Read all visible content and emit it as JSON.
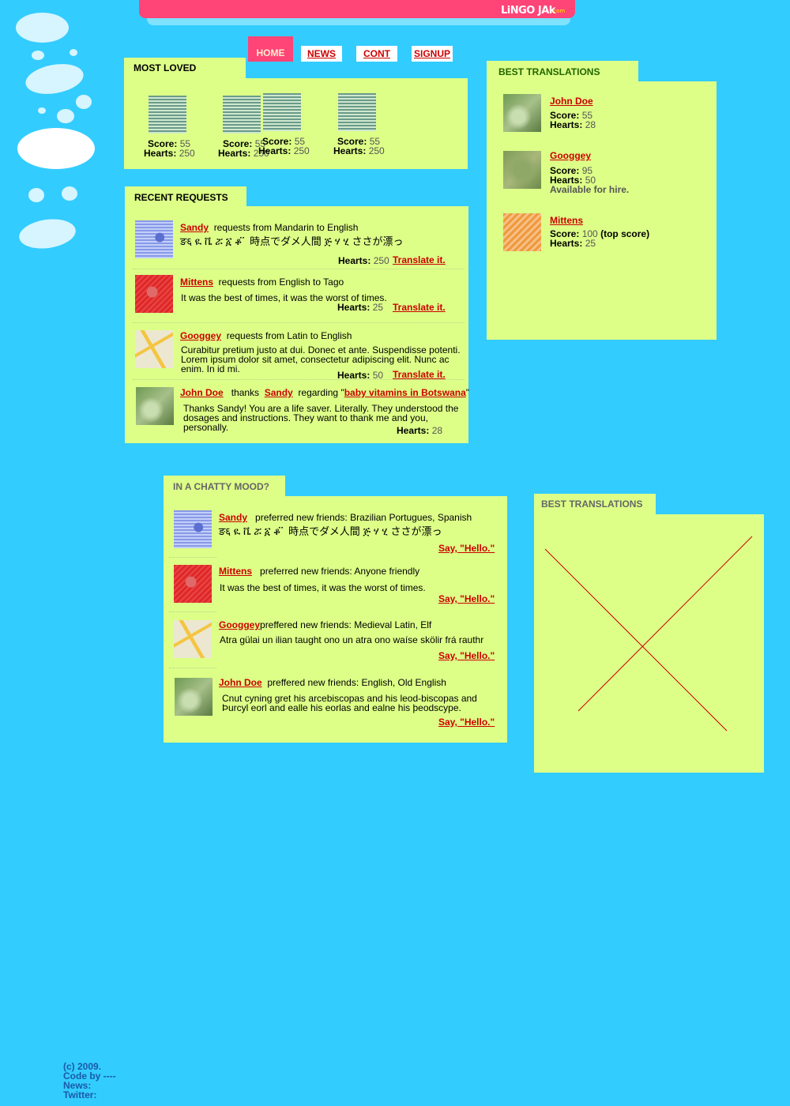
{
  "logo": {
    "name": "LiNGO JAk",
    "suffix": ".com"
  },
  "nav": {
    "home": "HOME",
    "news": "NEWS",
    "cont": "CONT",
    "signup": "SIGNUP"
  },
  "most_loved": {
    "title": "MOST LOVED",
    "items": [
      {
        "score_label": "Score:",
        "score": "55",
        "hearts_label": "Hearts:",
        "hearts": "250"
      },
      {
        "score_label": "Score:",
        "score": "55",
        "hearts_label": "Hearts:",
        "hearts": "250"
      },
      {
        "score_label": "Score:",
        "score": "55",
        "hearts_label": "Hearts:",
        "hearts": "250"
      },
      {
        "score_label": "Score:",
        "score": "55",
        "hearts_label": "Hearts:",
        "hearts": "250"
      }
    ]
  },
  "recent": {
    "title": "RECENT REQUESTS",
    "items": [
      {
        "user": "Sandy",
        "text": "requests from Mandarin to English",
        "body": "ङ६ ዪ ቬ ሯ ፩ ቆ ፞ ፞ 時点でダメ人間 ጅ ሃ ሂ ささが漂っ",
        "hearts_label": "Hearts:",
        "hearts": "250",
        "action": "Translate  it."
      },
      {
        "user": "Mittens",
        "text": "requests from English to Tago",
        "body": "It was the best of times, it was the worst of times.",
        "hearts_label": "Hearts:",
        "hearts": "25",
        "action": "Translate  it."
      },
      {
        "user": "Googgey",
        "text": "requests from Latin to English",
        "body": "Curabitur pretium justo at dui. Donec et ante. Suspendisse potenti. Lorem ipsum dolor sit amet, consectetur adipiscing elit. Nunc ac enim. In id mi.",
        "hearts_label": "Hearts:",
        "hearts": "50",
        "action": "Translate  it."
      },
      {
        "user": "John Doe",
        "thanks": "thanks",
        "target": "Sandy",
        "regarding": "regarding \"",
        "topic": "baby vitamins in Botswana",
        "close": "\"",
        "body": "Thanks Sandy!  You are a life saver. Literally. They understood the dosages and instructions. They want to thank me and you, personally.",
        "hearts_label": "Hearts:",
        "hearts": "28"
      }
    ]
  },
  "best_translations": {
    "title": "BEST TRANSLATIONS",
    "items": [
      {
        "user": "John Doe",
        "score_label": "Score:",
        "score": "55",
        "hearts_label": "Hearts:",
        "hearts": "28",
        "extra": ""
      },
      {
        "user": "Googgey",
        "score_label": "Score:",
        "score": "95",
        "hearts_label": "Hearts:",
        "hearts": "50",
        "extra": "Available for hire."
      },
      {
        "user": "Mittens",
        "score_label": "Score:",
        "score": "100",
        "score_note": "(top score)",
        "hearts_label": "Hearts:",
        "hearts": "25",
        "extra": ""
      }
    ]
  },
  "chatty": {
    "title": "IN A CHATTY MOOD?",
    "items": [
      {
        "user": "Sandy",
        "text": "preferred new friends: Brazilian Portugues, Spanish",
        "body": "ङ६ ዪ ቬ ሯ ፩ ቆ ፞ ፞ 時点でダメ人間 ጅ ሃ ሂ ささが漂っ",
        "action": "Say, \"Hello.\""
      },
      {
        "user": "Mittens",
        "text": "preferred new friends: Anyone friendly",
        "body": "It was the best of times, it was the worst of times.",
        "action": "Say, \"Hello.\""
      },
      {
        "user": "Googgey",
        "text": "preffered new friends: Medieval Latin, Elf",
        "body": "Atra gülai un ilian taught ono un atra ono waíse skölir frá rauthr",
        "action": "Say, \"Hello.\""
      },
      {
        "user": "John Doe",
        "text": "preffered new friends: English, Old English",
        "body": "Cnut cyning gret his arcebiscopas and his leod-biscopas and Þurcyl eorl and ealle his eorlas and ealne his þeodscype.",
        "action": "Say, \"Hello.\""
      }
    ]
  },
  "best_translations_2": {
    "title": "BEST TRANSLATIONS"
  },
  "footer": {
    "line1": "(c) 2009.",
    "line2": "Code by ----",
    "line3": "News:",
    "line4": "Twitter:"
  },
  "colors": {
    "background": "#33ccff",
    "panel": "#ddff88",
    "accent": "#ff4477",
    "link": "#cc0000"
  }
}
